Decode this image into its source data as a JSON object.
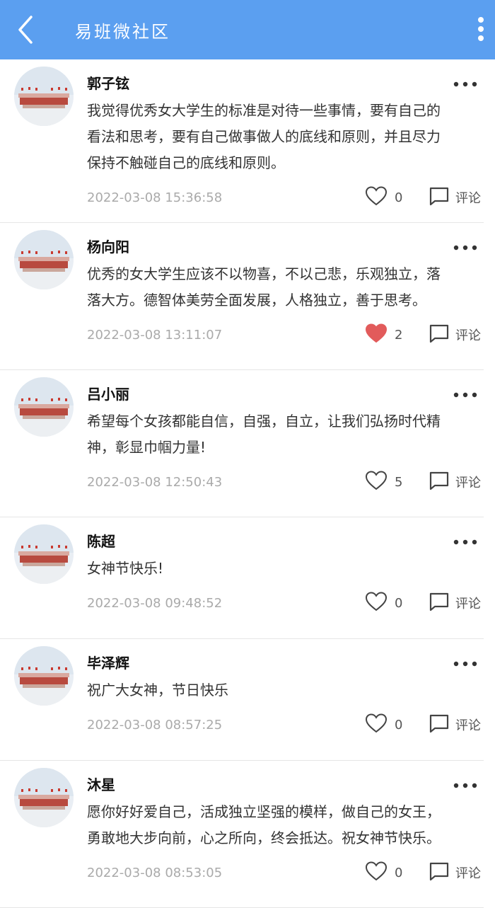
{
  "header": {
    "title": "易班微社区",
    "back_icon": "chevron-left-icon",
    "menu_icon": "more-vertical-icon",
    "color": "#5b9ff0"
  },
  "labels": {
    "comment": "评论"
  },
  "colors": {
    "liked": "#e25b5b",
    "unliked": "#555555"
  },
  "posts": [
    {
      "author": "郭子铉",
      "lines": [
        "我觉得优秀女大学生的标准是对待一些事情，要有自己的",
        "看法和思考，要有自己做事做人的底线和原则，并且尽力",
        "保持不触碰自己的底线和原则。"
      ],
      "time": "2022-03-08 15:36:58",
      "likes": "0",
      "liked": false
    },
    {
      "author": "杨向阳",
      "lines": [
        "优秀的女大学生应该不以物喜，不以己悲，乐观独立，落",
        "落大方。德智体美劳全面发展，人格独立，善于思考。"
      ],
      "time": "2022-03-08 13:11:07",
      "likes": "2",
      "liked": true
    },
    {
      "author": "吕小丽",
      "lines": [
        "希望每个女孩都能自信，自强，自立，让我们弘扬时代精",
        "神，彰显巾帼力量!"
      ],
      "time": "2022-03-08 12:50:43",
      "likes": "5",
      "liked": false
    },
    {
      "author": "陈超",
      "lines": [
        "女神节快乐!"
      ],
      "time": "2022-03-08 09:48:52",
      "likes": "0",
      "liked": false
    },
    {
      "author": "毕泽辉",
      "lines": [
        "祝广大女神，节日快乐"
      ],
      "time": "2022-03-08 08:57:25",
      "likes": "0",
      "liked": false
    },
    {
      "author": "沐星",
      "lines": [
        "愿你好好爱自己，活成独立坚强的模样，做自己的女王，",
        "勇敢地大步向前，心之所向，终会抵达。祝女神节快乐。"
      ],
      "time": "2022-03-08 08:53:05",
      "likes": "0",
      "liked": false
    }
  ]
}
